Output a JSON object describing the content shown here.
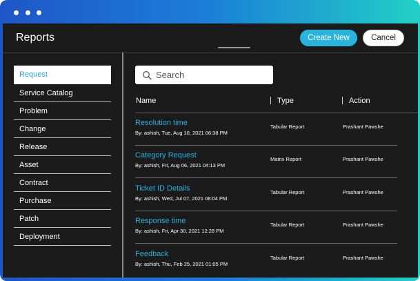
{
  "header": {
    "title": "Reports",
    "create_label": "Create New",
    "cancel_label": "Cancel"
  },
  "sidebar": {
    "items": [
      {
        "label": "Request",
        "active": true
      },
      {
        "label": "Service Catalog"
      },
      {
        "label": "Problem"
      },
      {
        "label": "Change"
      },
      {
        "label": "Release"
      },
      {
        "label": "Asset"
      },
      {
        "label": "Contract"
      },
      {
        "label": "Purchase"
      },
      {
        "label": "Patch"
      },
      {
        "label": "Deployment"
      }
    ]
  },
  "search": {
    "placeholder": "Search"
  },
  "table": {
    "columns": [
      "Name",
      "Type",
      "Action"
    ],
    "rows": [
      {
        "name": "Resolution time",
        "meta": "By: ashish, Tue, Aug 10, 2021 06:38 PM",
        "type": "Tabular Report",
        "action": "Prashant Pawshe"
      },
      {
        "name": "Category Request",
        "meta": "By: ashish, Fri, Aug 06, 2021 04:13 PM",
        "type": "Matrix Report",
        "action": "Prashant Pawshe"
      },
      {
        "name": "Ticket ID Details",
        "meta": "By: ashish, Wed, Jul 07, 2021 08:04 PM",
        "type": "Tabular Report",
        "action": "Prashant Pawshe"
      },
      {
        "name": "Response time",
        "meta": "By: ashish, Fri, Apr 30, 2021 12:28 PM",
        "type": "Tabular Report",
        "action": "Prashant Pawshe"
      },
      {
        "name": "Feedback",
        "meta": "By: ashish, Thu, Feb 25, 2021 01:05 PM",
        "type": "Tabular Report",
        "action": "Prashant Pawshe"
      }
    ]
  },
  "colors": {
    "accent": "#28b4dd",
    "link": "#2ab0e0",
    "background": "#1b1b1b",
    "gradient_start": "#1f56c7",
    "gradient_end": "#22d0c6"
  }
}
